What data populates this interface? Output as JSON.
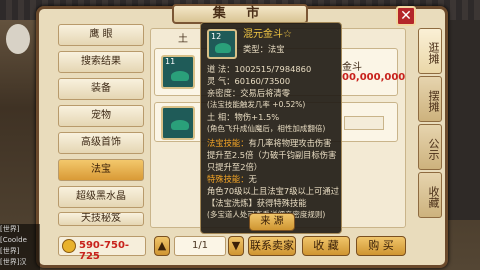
{
  "window": {
    "title": "集 市",
    "close_icon": "close-icon"
  },
  "categories": [
    {
      "label": "鹰 眼",
      "selected": false
    },
    {
      "label": "搜索结果",
      "selected": false
    },
    {
      "label": "装备",
      "selected": false
    },
    {
      "label": "宠物",
      "selected": false
    },
    {
      "label": "高级首饰",
      "selected": false
    },
    {
      "label": "法宝",
      "selected": true
    },
    {
      "label": "超级黑水晶",
      "selected": false
    },
    {
      "label": "天技秘笈",
      "selected": false
    }
  ],
  "list": {
    "header_partial": "土",
    "row1": {
      "qty": "11",
      "name_partial": "金斗",
      "price_partial": "00,000,000"
    }
  },
  "side_tabs": [
    "逛摊",
    "摆摊",
    "公示",
    "收藏"
  ],
  "tooltip": {
    "item_name": "混元金斗",
    "star": "☆",
    "qty": "12",
    "type": "类型：法宝",
    "dao_fa_label": "道 法：",
    "dao_fa": "1002515/7984860",
    "ling_qi_label": "灵 气：",
    "ling_qi": "60160/73500",
    "trade_label": "亲密度：",
    "trade": "交易后将清零",
    "skill_rate": "(法宝技能触发几率 +0.52%)",
    "xiang_label": "土 相：",
    "xiang": "物伤+1.5%",
    "xiang_note": "(角色飞升成仙魔后，相性加成翻倍)",
    "fabao_skill_label": "法宝技能：",
    "fabao_skill": "有几率将物理攻击伤害提升至2.5倍（力破千钧副目标伤害只提升至2倍）",
    "special_label": "特殊技能：",
    "special": "无",
    "special_desc": "角色70级以上且法宝7级以上可通过",
    "special_desc2": "【法宝洗炼】获得特殊技能",
    "special_note": "(多宝道人处可查看详细亲密度规则)",
    "source_button": "来 源"
  },
  "footer": {
    "money": "590-750-725",
    "page": "1/1",
    "contact_seller": "联系卖家",
    "favorite": "收 藏",
    "buy": "购 买"
  },
  "chat": [
    "[世界]",
    "[Coolde",
    "[世界]",
    "[世界]汉",
    "[世界]"
  ]
}
